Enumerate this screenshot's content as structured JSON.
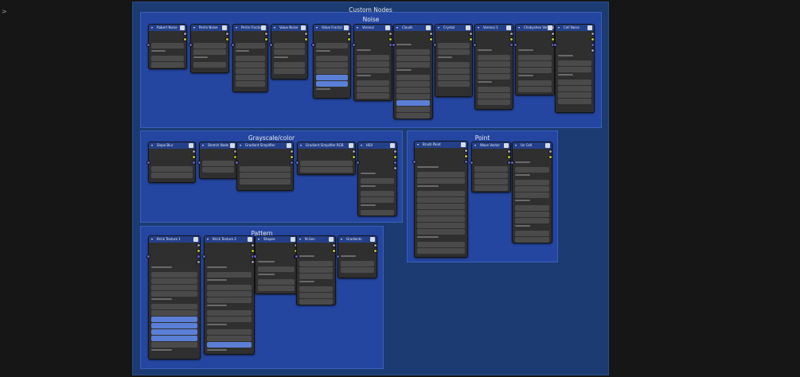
{
  "main_title": "Custom Nodes",
  "corner_arrow": ">",
  "frames": [
    {
      "id": "noise",
      "title": "Noise"
    },
    {
      "id": "grayscale",
      "title": "Grayscale/color"
    },
    {
      "id": "point",
      "title": "Point"
    },
    {
      "id": "pattern",
      "title": "Pattern"
    }
  ],
  "nodes": [
    {
      "title": "Robert Noise",
      "type": "generic"
    },
    {
      "title": "Perlin Noise",
      "type": "generic"
    },
    {
      "title": "Perlin Fractal",
      "type": "generic"
    },
    {
      "title": "Value Noise",
      "type": "generic"
    },
    {
      "title": "Value Fractal",
      "type": "generic"
    },
    {
      "title": "Voronoi",
      "type": "generic"
    },
    {
      "title": "Clouds",
      "type": "generic"
    },
    {
      "title": "Crystal",
      "type": "generic"
    },
    {
      "title": "Voronoi 1",
      "type": "generic"
    },
    {
      "title": "Chebyshev Voronoi",
      "type": "generic"
    },
    {
      "title": "Cell Noise",
      "type": "generic"
    },
    {
      "title": "Slope Blur",
      "type": "generic"
    },
    {
      "title": "Stretch Node",
      "type": "generic"
    },
    {
      "title": "Gradient Simplifier",
      "type": "generic"
    },
    {
      "title": "Gradient Simplifier RGB",
      "type": "generic"
    },
    {
      "title": "HSV",
      "type": "generic"
    },
    {
      "title": "Brush Paint",
      "type": "generic"
    },
    {
      "title": "Wave Vector",
      "type": "generic"
    },
    {
      "title": "Uv Cell",
      "type": "generic"
    },
    {
      "title": "Brick Texture 1",
      "type": "generic"
    },
    {
      "title": "Brick Texture 2",
      "type": "generic"
    },
    {
      "title": "Shapes",
      "type": "generic"
    },
    {
      "title": "N-Gon",
      "type": "generic"
    },
    {
      "title": "Gradients",
      "type": "generic"
    }
  ]
}
